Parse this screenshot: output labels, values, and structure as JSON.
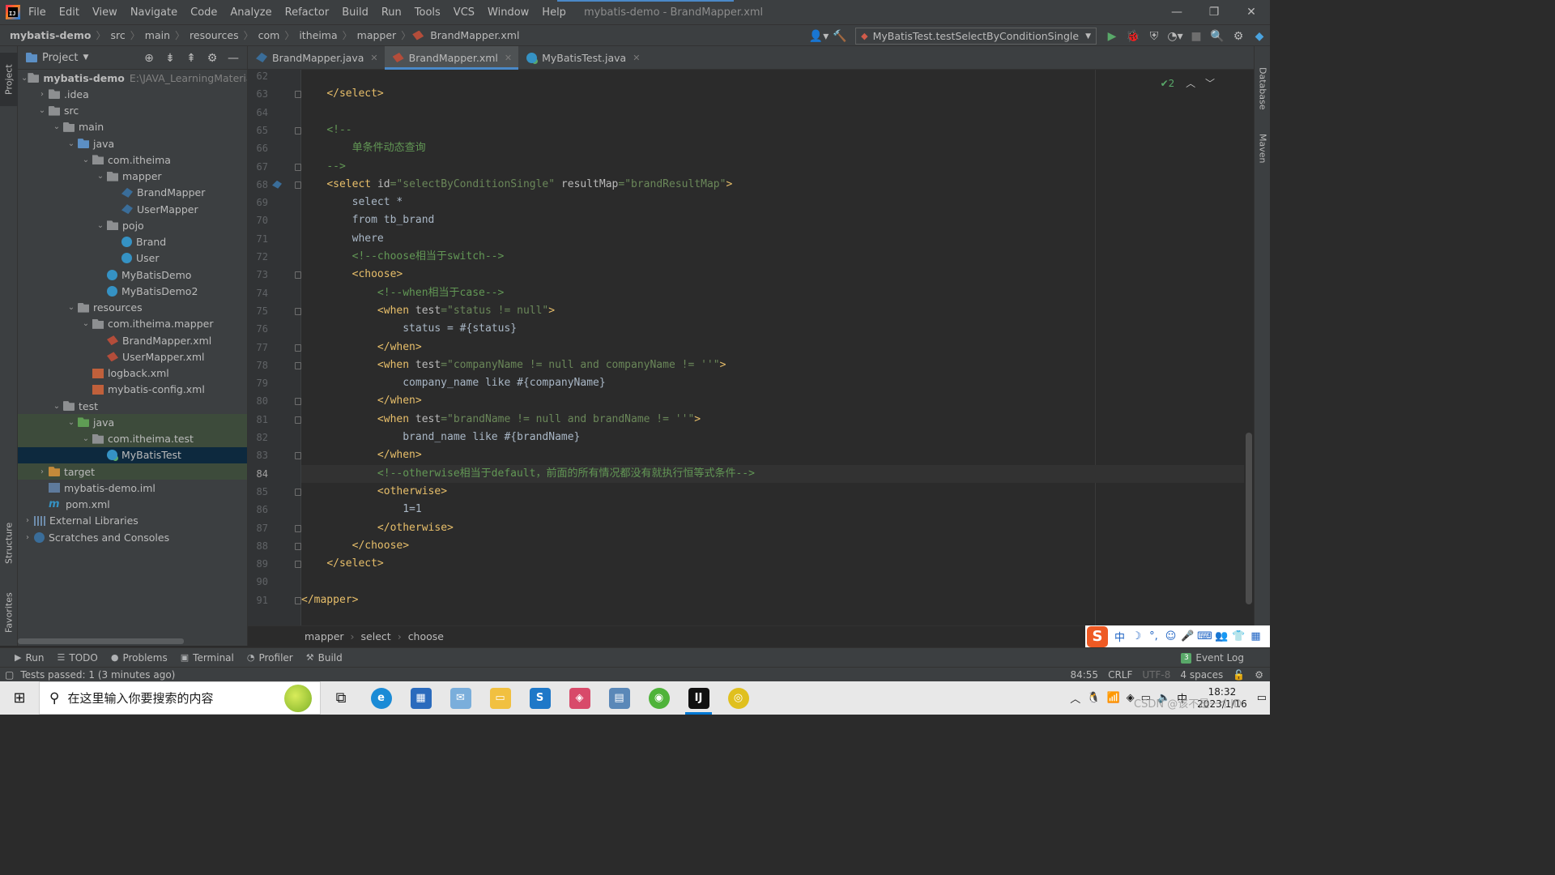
{
  "window": {
    "title": "mybatis-demo - BrandMapper.xml",
    "menu": [
      "File",
      "Edit",
      "View",
      "Navigate",
      "Code",
      "Analyze",
      "Refactor",
      "Build",
      "Run",
      "Tools",
      "VCS",
      "Window",
      "Help"
    ],
    "controls": {
      "minimize": "—",
      "restore": "❐",
      "close": "✕"
    }
  },
  "breadcrumb": [
    "mybatis-demo",
    "src",
    "main",
    "resources",
    "com",
    "itheima",
    "mapper",
    "BrandMapper.xml"
  ],
  "run_config": "MyBatisTest.testSelectByConditionSingle",
  "project_panel": {
    "title": "Project",
    "tree": [
      {
        "label": "mybatis-demo",
        "path": "E:\\JAVA_LearningMaterials",
        "icon": "folder",
        "depth": 0,
        "expanded": true,
        "bold": true
      },
      {
        "label": ".idea",
        "icon": "folder",
        "depth": 1,
        "expanded": false
      },
      {
        "label": "src",
        "icon": "folder",
        "depth": 1,
        "expanded": true
      },
      {
        "label": "main",
        "icon": "folder",
        "depth": 2,
        "expanded": true
      },
      {
        "label": "java",
        "icon": "folder-blue",
        "depth": 3,
        "expanded": true
      },
      {
        "label": "com.itheima",
        "icon": "package",
        "depth": 4,
        "expanded": true
      },
      {
        "label": "mapper",
        "icon": "package",
        "depth": 5,
        "expanded": true
      },
      {
        "label": "BrandMapper",
        "icon": "mapper",
        "depth": 6
      },
      {
        "label": "UserMapper",
        "icon": "mapper",
        "depth": 6
      },
      {
        "label": "pojo",
        "icon": "package",
        "depth": 5,
        "expanded": true
      },
      {
        "label": "Brand",
        "icon": "class",
        "depth": 6
      },
      {
        "label": "User",
        "icon": "class",
        "depth": 6
      },
      {
        "label": "MyBatisDemo",
        "icon": "class",
        "depth": 5
      },
      {
        "label": "MyBatisDemo2",
        "icon": "class",
        "depth": 5
      },
      {
        "label": "resources",
        "icon": "folder",
        "depth": 3,
        "expanded": true
      },
      {
        "label": "com.itheima.mapper",
        "icon": "package",
        "depth": 4,
        "expanded": true
      },
      {
        "label": "BrandMapper.xml",
        "icon": "xml",
        "depth": 5
      },
      {
        "label": "UserMapper.xml",
        "icon": "xml",
        "depth": 5
      },
      {
        "label": "logback.xml",
        "icon": "config",
        "depth": 4
      },
      {
        "label": "mybatis-config.xml",
        "icon": "config",
        "depth": 4
      },
      {
        "label": "test",
        "icon": "folder",
        "depth": 2,
        "expanded": true
      },
      {
        "label": "java",
        "icon": "folder-green",
        "depth": 3,
        "expanded": true,
        "highlight": true
      },
      {
        "label": "com.itheima.test",
        "icon": "package",
        "depth": 4,
        "expanded": true,
        "highlight": true
      },
      {
        "label": "MyBatisTest",
        "icon": "test-class",
        "depth": 5,
        "selected": true
      },
      {
        "label": "target",
        "icon": "folder-orange",
        "depth": 1,
        "expanded": false,
        "highlight": true
      },
      {
        "label": "mybatis-demo.iml",
        "icon": "iml",
        "depth": 1
      },
      {
        "label": "pom.xml",
        "icon": "pom",
        "depth": 1
      },
      {
        "label": "External Libraries",
        "icon": "library",
        "depth": 0,
        "expanded": false
      },
      {
        "label": "Scratches and Consoles",
        "icon": "scratch",
        "depth": 0,
        "expanded": false
      }
    ]
  },
  "tabs": [
    {
      "label": "BrandMapper.java",
      "active": false
    },
    {
      "label": "BrandMapper.xml",
      "active": true
    },
    {
      "label": "MyBatisTest.java",
      "active": false
    }
  ],
  "editor": {
    "inspection": "✔2",
    "current_line": 84,
    "lines": [
      {
        "n": 62,
        "html": ""
      },
      {
        "n": 63,
        "html": "    <span class='tg'>&lt;/select&gt;</span>"
      },
      {
        "n": 64,
        "html": ""
      },
      {
        "n": 65,
        "html": "    <span class='cm'>&lt;!--</span>"
      },
      {
        "n": 66,
        "html": "<span class='cm'>        单条件动态查询</span>"
      },
      {
        "n": 67,
        "html": "    <span class='cm'>--&gt;</span>"
      },
      {
        "n": 68,
        "html": "    <span class='tg'>&lt;select </span><span class='at'>id</span><span class='av'>=\"selectByConditionSingle\"</span> <span class='at'>resultMap</span><span class='av'>=\"brandResultMap\"</span><span class='tg'>&gt;</span>"
      },
      {
        "n": 69,
        "html": "        select *"
      },
      {
        "n": 70,
        "html": "        from tb_brand"
      },
      {
        "n": 71,
        "html": "        where"
      },
      {
        "n": 72,
        "html": "        <span class='cm'>&lt;!--choose相当于switch--&gt;</span>"
      },
      {
        "n": 73,
        "html": "        <span class='tg'>&lt;choose&gt;</span>"
      },
      {
        "n": 74,
        "html": "            <span class='cm'>&lt;!--when相当于case--&gt;</span>"
      },
      {
        "n": 75,
        "html": "            <span class='tg'>&lt;when </span><span class='at'>test</span><span class='av'>=\"status != null\"</span><span class='tg'>&gt;</span>"
      },
      {
        "n": 76,
        "html": "                status = #{status}"
      },
      {
        "n": 77,
        "html": "            <span class='tg'>&lt;/when&gt;</span>"
      },
      {
        "n": 78,
        "html": "            <span class='tg'>&lt;when </span><span class='at'>test</span><span class='av'>=\"companyName != null and companyName != ''\"</span><span class='tg'>&gt;</span>"
      },
      {
        "n": 79,
        "html": "                company_name like #{companyName}"
      },
      {
        "n": 80,
        "html": "            <span class='tg'>&lt;/when&gt;</span>"
      },
      {
        "n": 81,
        "html": "            <span class='tg'>&lt;when </span><span class='at'>test</span><span class='av'>=\"brandName != null and brandName != ''\"</span><span class='tg'>&gt;</span>"
      },
      {
        "n": 82,
        "html": "                brand_name like #{brandName}"
      },
      {
        "n": 83,
        "html": "            <span class='tg'>&lt;/when&gt;</span>"
      },
      {
        "n": 84,
        "html": "            <span class='cm'>&lt;!--otherwise相当于default，前面的所有情况都没有就执行恒等式条件--&gt;</span>"
      },
      {
        "n": 85,
        "html": "            <span class='tg'>&lt;otherwise&gt;</span>"
      },
      {
        "n": 86,
        "html": "                1=1"
      },
      {
        "n": 87,
        "html": "            <span class='tg'>&lt;/otherwise&gt;</span>"
      },
      {
        "n": 88,
        "html": "        <span class='tg'>&lt;/choose&gt;</span>"
      },
      {
        "n": 89,
        "html": "    <span class='tg'>&lt;/select&gt;</span>"
      },
      {
        "n": 90,
        "html": ""
      },
      {
        "n": 91,
        "html": "<span class='tg'>&lt;/mapper&gt;</span>"
      }
    ]
  },
  "editor_breadcrumb": [
    "mapper",
    "select",
    "choose"
  ],
  "tool_windows": [
    "Run",
    "TODO",
    "Problems",
    "Terminal",
    "Profiler",
    "Build"
  ],
  "event_log": {
    "count": "3",
    "label": "Event Log"
  },
  "side_tabs": {
    "left_top": "Project",
    "left_mid": "Structure",
    "left_bottom": "Favorites",
    "right_top": "Database",
    "right_mid": "Maven"
  },
  "status": {
    "message": "Tests passed: 1 (3 minutes ago)",
    "position": "84:55",
    "line_sep": "CRLF",
    "encoding": "UTF-8",
    "indent": "4 spaces"
  },
  "taskbar": {
    "search_placeholder": "在这里输入你要搜索的内容",
    "time": "18:32",
    "date": "2023/1/16",
    "ime": "中",
    "watermark": "CSDN @该不是一个ID"
  }
}
